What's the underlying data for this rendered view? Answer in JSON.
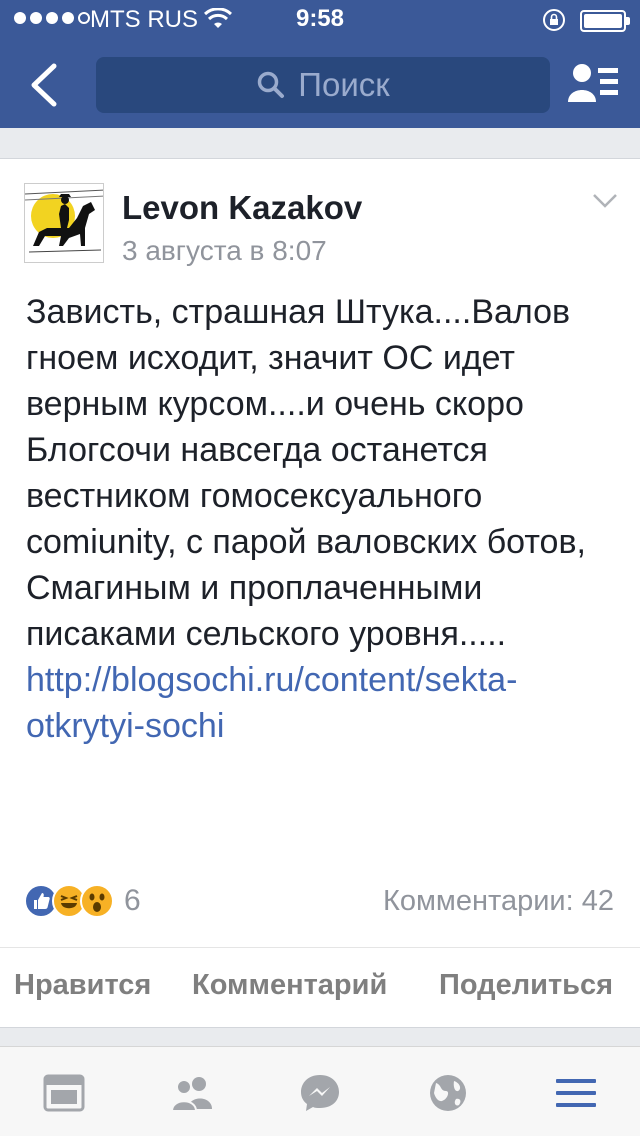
{
  "status_bar": {
    "carrier": "MTS RUS",
    "time": "9:58"
  },
  "header": {
    "search_placeholder": "Поиск"
  },
  "post": {
    "author": "Levon Kazakov",
    "timestamp": "3 августа в 8:07",
    "text": "Зависть, страшная Штука....Валов гноем исходит, значит ОС идет верным курсом....и очень скоро Блогсочи навсегда останется вестником гомосексуального comiunity, с парой валовских ботов, Смагиным и проплаченными писаками сельского уровня.....",
    "link": "http://blogsochi.ru/content/sekta-otkrytyi-sochi",
    "reactions_count": "6",
    "comments_count": "Комментарии: 42"
  },
  "actions": {
    "like": "Нравится",
    "comment": "Комментарий",
    "share": "Поделиться"
  },
  "colors": {
    "brand": "#3b5998",
    "link": "#4267b2",
    "active_tab": "#4267b2",
    "inactive_tab": "#a3a6ab"
  }
}
